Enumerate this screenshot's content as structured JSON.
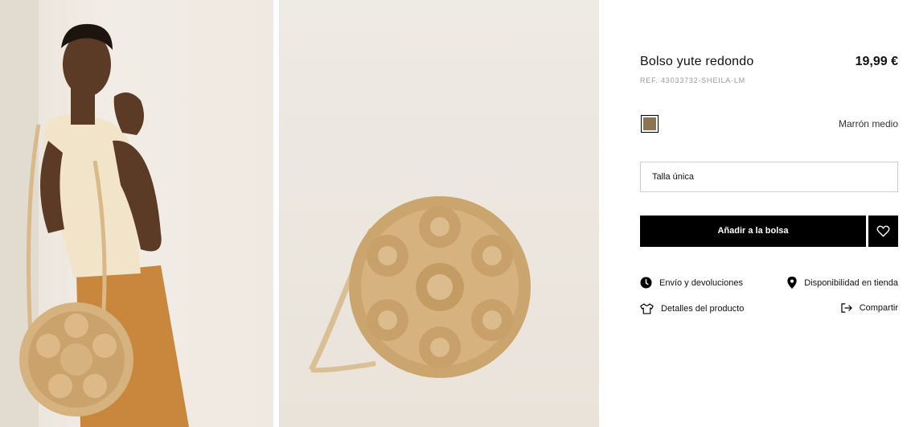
{
  "product": {
    "title": "Bolso yute redondo",
    "price": "19,99 €",
    "ref": "REF. 43033732-SHEILA-LM"
  },
  "color": {
    "name": "Marrón medio",
    "swatch_hex": "#8a7554"
  },
  "size": {
    "selected": "Talla única"
  },
  "actions": {
    "add_to_bag": "Añadir a la bolsa"
  },
  "links": {
    "shipping": "Envío y devoluciones",
    "store_availability": "Disponibilidad en tienda",
    "product_details": "Detalles del producto",
    "share": "Compartir"
  },
  "icons": {
    "shipping": "clock-icon",
    "store_availability": "location-pin-icon",
    "product_details": "tshirt-icon",
    "share": "share-icon",
    "favorite": "heart-icon"
  }
}
